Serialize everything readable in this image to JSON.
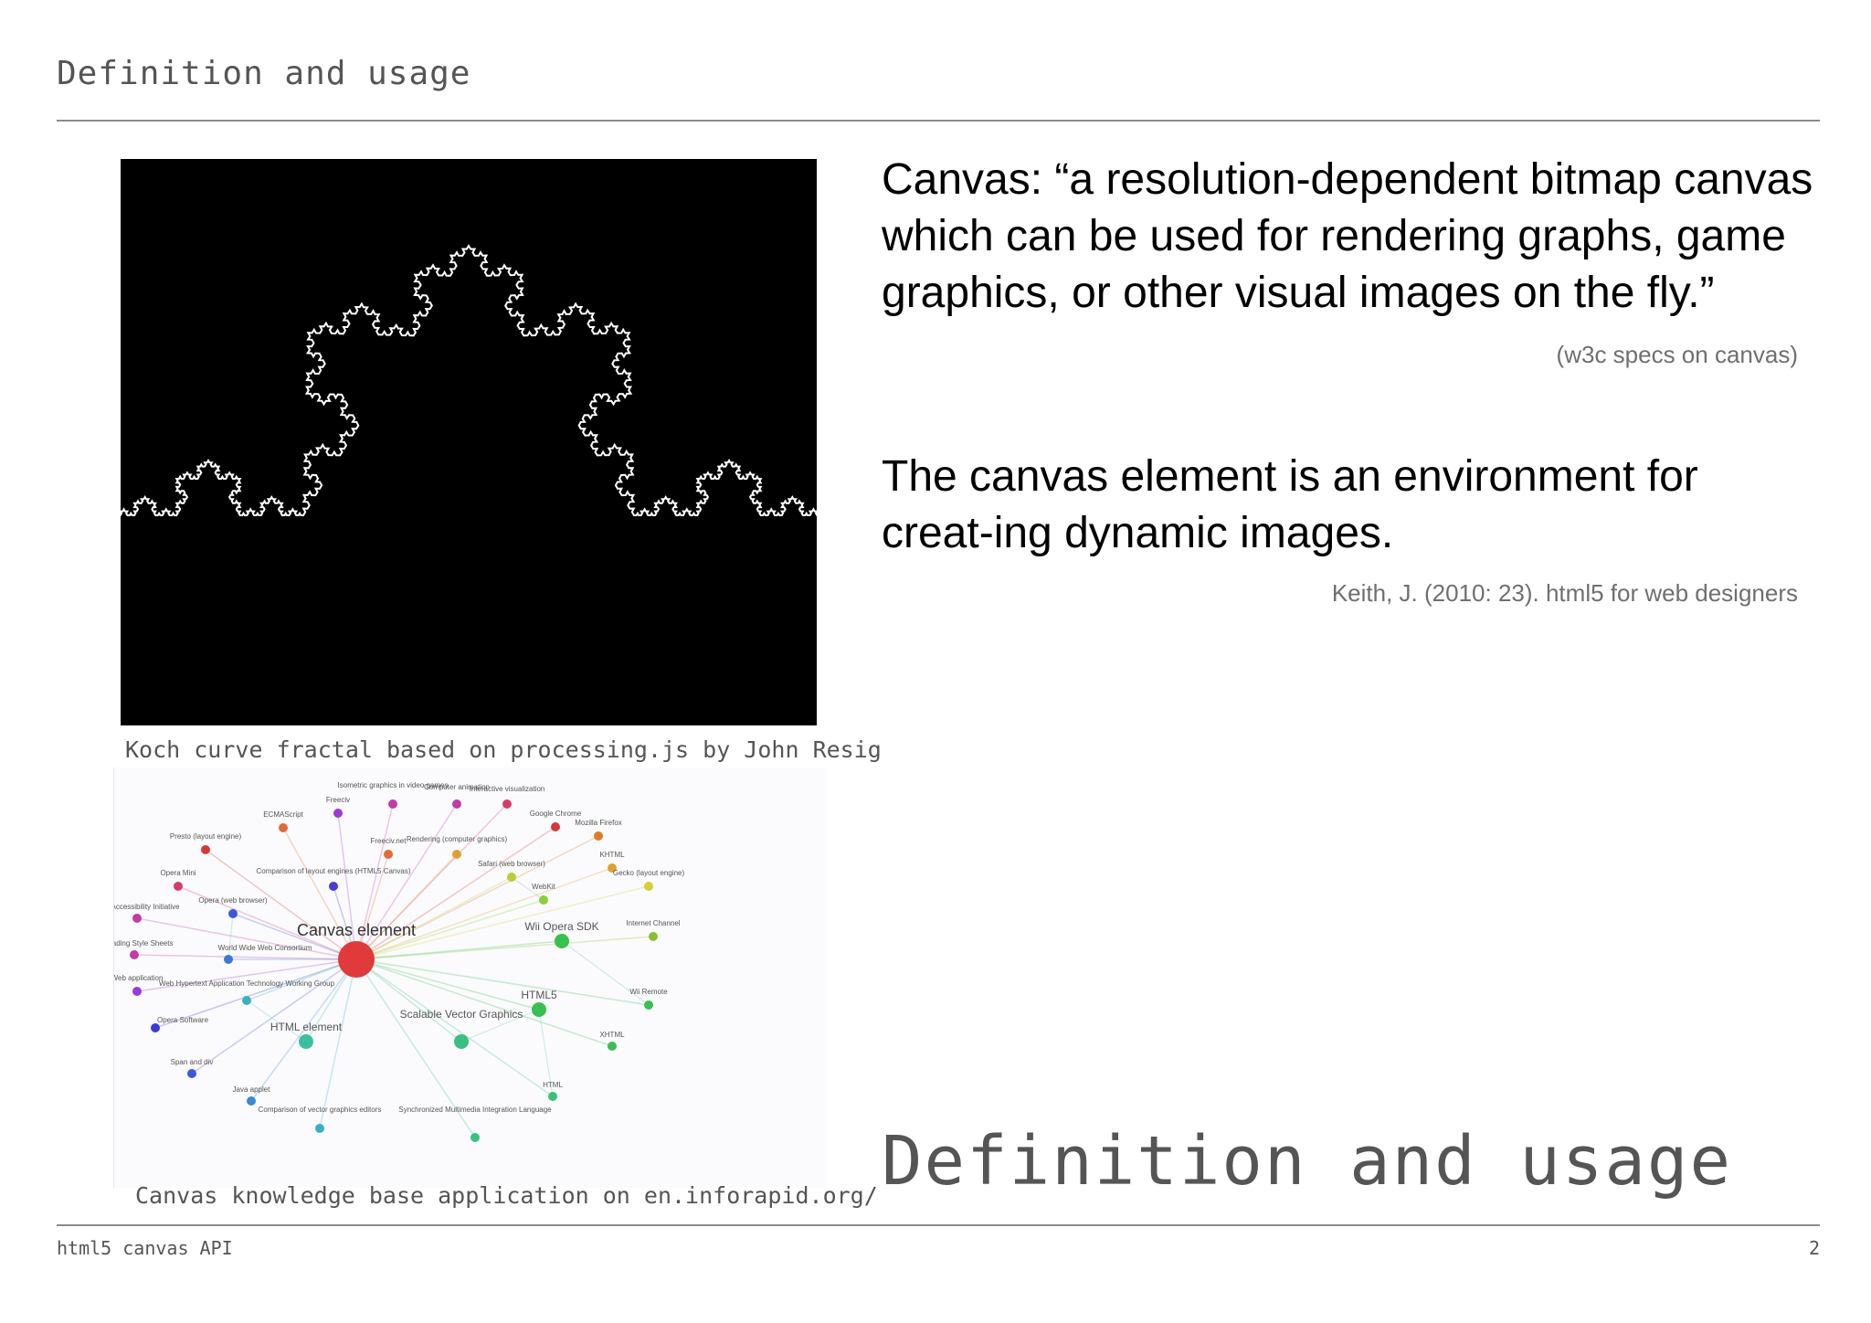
{
  "header": {
    "title": "Definition and usage"
  },
  "left": {
    "koch_caption": "Koch curve fractal based on processing.js by John Resig",
    "graph_caption": "Canvas knowledge base application on en.inforapid.org/",
    "graph": {
      "central": "Canvas element",
      "nodes": [
        {
          "label": "Isometric graphics in video games",
          "color": "#c23aa8"
        },
        {
          "label": "Computer animation",
          "color": "#c23aa8"
        },
        {
          "label": "Interactive visualization",
          "color": "#d63b6a"
        },
        {
          "label": "Freeciv",
          "color": "#9b3ad6"
        },
        {
          "label": "ECMAScript",
          "color": "#e06a3a"
        },
        {
          "label": "Google Chrome",
          "color": "#d6373a"
        },
        {
          "label": "Mozilla Firefox",
          "color": "#e07a2a"
        },
        {
          "label": "Presto (layout engine)",
          "color": "#d6373a"
        },
        {
          "label": "Freeciv.net",
          "color": "#e06a3a"
        },
        {
          "label": "Rendering (computer graphics)",
          "color": "#e0a030"
        },
        {
          "label": "KHTML",
          "color": "#e0a030"
        },
        {
          "label": "Comparison of layout engines (HTML5 Canvas)",
          "color": "#4a3ad6"
        },
        {
          "label": "Safari (web browser)",
          "color": "#b8d030"
        },
        {
          "label": "Opera Mini",
          "color": "#d63b6a"
        },
        {
          "label": "Gecko (layout engine)",
          "color": "#d6d030"
        },
        {
          "label": "WebKit",
          "color": "#8ad030"
        },
        {
          "label": "Opera (web browser)",
          "color": "#3a5ad6"
        },
        {
          "label": "Web Accessibility Initiative",
          "color": "#c23aa8"
        },
        {
          "label": "Internet Channel",
          "color": "#8ac030"
        },
        {
          "label": "Wii Opera SDK",
          "color": "#3ac050"
        },
        {
          "label": "Cascading Style Sheets",
          "color": "#c23aa8"
        },
        {
          "label": "World Wide Web Consortium",
          "color": "#3a7ad6"
        },
        {
          "label": "Web application",
          "color": "#9b3ad6"
        },
        {
          "label": "Web Hypertext Application Technology Working Group",
          "color": "#3ab0c0"
        },
        {
          "label": "Wii Remote",
          "color": "#3ac050"
        },
        {
          "label": "HTML5",
          "color": "#3ac050"
        },
        {
          "label": "Opera Software",
          "color": "#3a3ad6"
        },
        {
          "label": "Scalable Vector Graphics",
          "color": "#3ac080"
        },
        {
          "label": "HTML element",
          "color": "#3ac0a0"
        },
        {
          "label": "XHTML",
          "color": "#3ac050"
        },
        {
          "label": "Span and div",
          "color": "#3a5ad6"
        },
        {
          "label": "Java applet",
          "color": "#3a8ad6"
        },
        {
          "label": "HTML",
          "color": "#3ac080"
        },
        {
          "label": "Comparison of vector graphics editors",
          "color": "#3ab0c0"
        },
        {
          "label": "Synchronized Multimedia Integration Language",
          "color": "#3ac080"
        }
      ]
    }
  },
  "right": {
    "quote1": "Canvas: “a resolution-dependent bitmap canvas which can be used for rendering graphs, game graphics, or other visual images on the fly.”",
    "source1": "(w3c specs on canvas)",
    "quote2": "The canvas element is an environment for creat-ing dynamic images.",
    "source2": "Keith, J. (2010: 23). html5 for web designers",
    "big_title": "Definition and usage"
  },
  "footer": {
    "left": "html5 canvas API",
    "page": "2"
  },
  "colors": {
    "accent_rule": "#8a8a8a",
    "text_gray": "#555555",
    "central_node": "#e03a3a"
  }
}
